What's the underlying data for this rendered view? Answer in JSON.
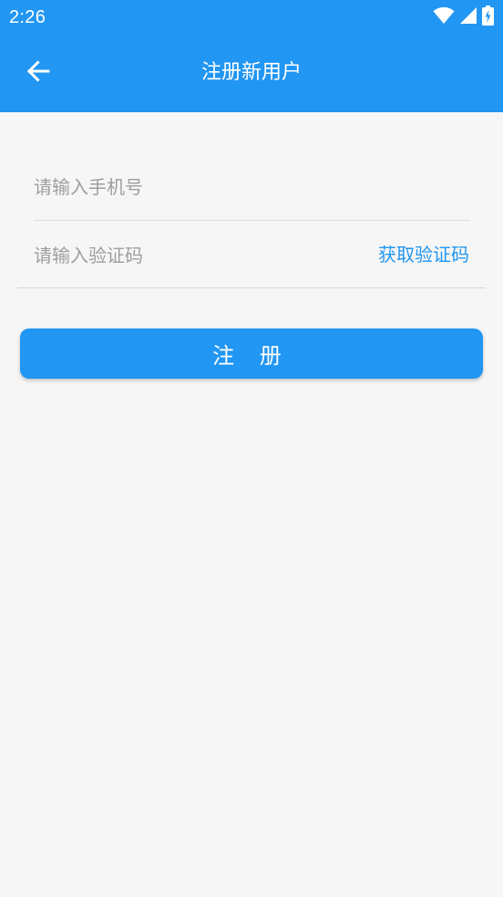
{
  "status_bar": {
    "time": "2:26",
    "icons": [
      "wifi-icon",
      "cellular-signal-icon",
      "battery-charging-icon"
    ]
  },
  "app_bar": {
    "back_icon": "arrow-back-icon",
    "title": "注册新用户"
  },
  "form": {
    "phone_placeholder": "请输入手机号",
    "phone_value": "",
    "code_placeholder": "请输入验证码",
    "code_value": "",
    "get_code_label": "获取验证码"
  },
  "register_button_label": "注 册",
  "colors": {
    "primary": "#2196f3",
    "background": "#f6f6f6",
    "placeholder": "#9e9e9e",
    "divider": "#dcdcdc"
  }
}
